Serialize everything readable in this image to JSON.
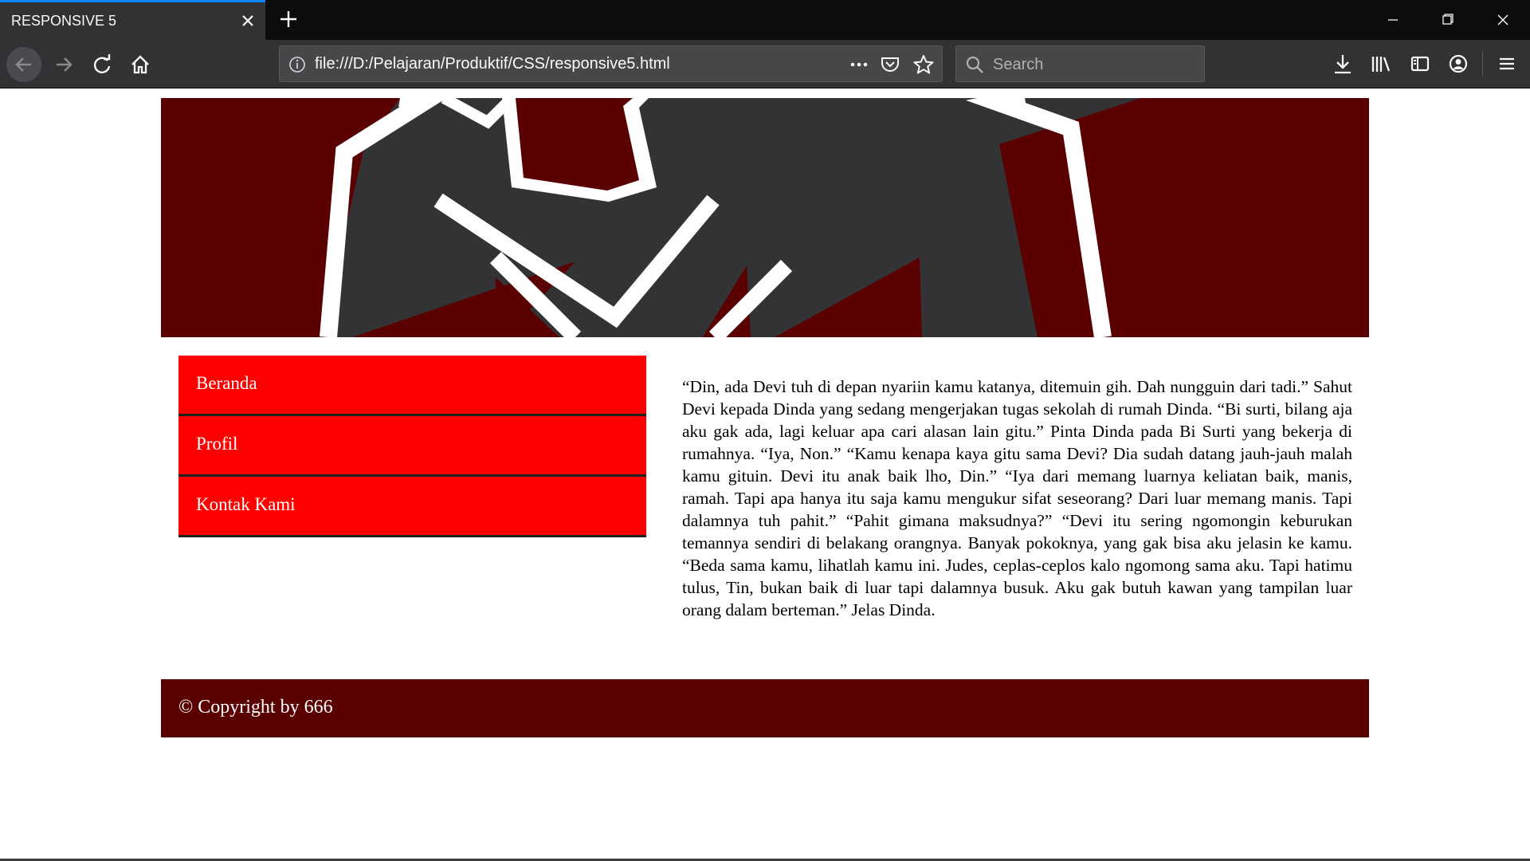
{
  "browser": {
    "tab_title": "RESPONSIVE 5",
    "url": "file:///D:/Pelajaran/Produktif/CSS/responsive5.html",
    "search_placeholder": "Search",
    "accent_color": "#0a84ff"
  },
  "page": {
    "menu": [
      {
        "label": "Beranda"
      },
      {
        "label": "Profil"
      },
      {
        "label": "Kontak Kami"
      }
    ],
    "article_text": "“Din, ada Devi tuh di depan nyariin kamu katanya, ditemuin gih. Dah nungguin dari tadi.” Sahut Devi kepada Dinda yang sedang mengerjakan tugas sekolah di rumah Dinda. “Bi surti, bilang aja aku gak ada, lagi keluar apa cari alasan lain gitu.” Pinta Dinda pada Bi Surti yang bekerja di rumahnya. “Iya, Non.” “Kamu kenapa kaya gitu sama Devi? Dia sudah datang jauh-jauh malah kamu gituin. Devi itu anak baik lho, Din.” “Iya dari memang luarnya keliatan baik, manis, ramah. Tapi apa hanya itu saja kamu mengukur sifat seseorang? Dari luar memang manis. Tapi dalamnya tuh pahit.” “Pahit gimana maksudnya?” “Devi itu sering ngomongin keburukan temannya sendiri di belakang orangnya. Banyak pokoknya, yang gak bisa aku jelasin ke kamu. “Beda sama kamu, lihatlah kamu ini. Judes, ceplas-ceplos kalo ngomong sama aku. Tapi hatimu tulus, Tin, bukan baik di luar tapi dalamnya busuk. Aku gak butuh kawan yang tampilan luar orang dalam berteman.” Jelas Dinda.",
    "footer_text": "© Copyright by 666",
    "colors": {
      "menu_bg": "#ff0000",
      "banner_bg": "#5b0000",
      "footer_bg": "#5b0000"
    }
  }
}
